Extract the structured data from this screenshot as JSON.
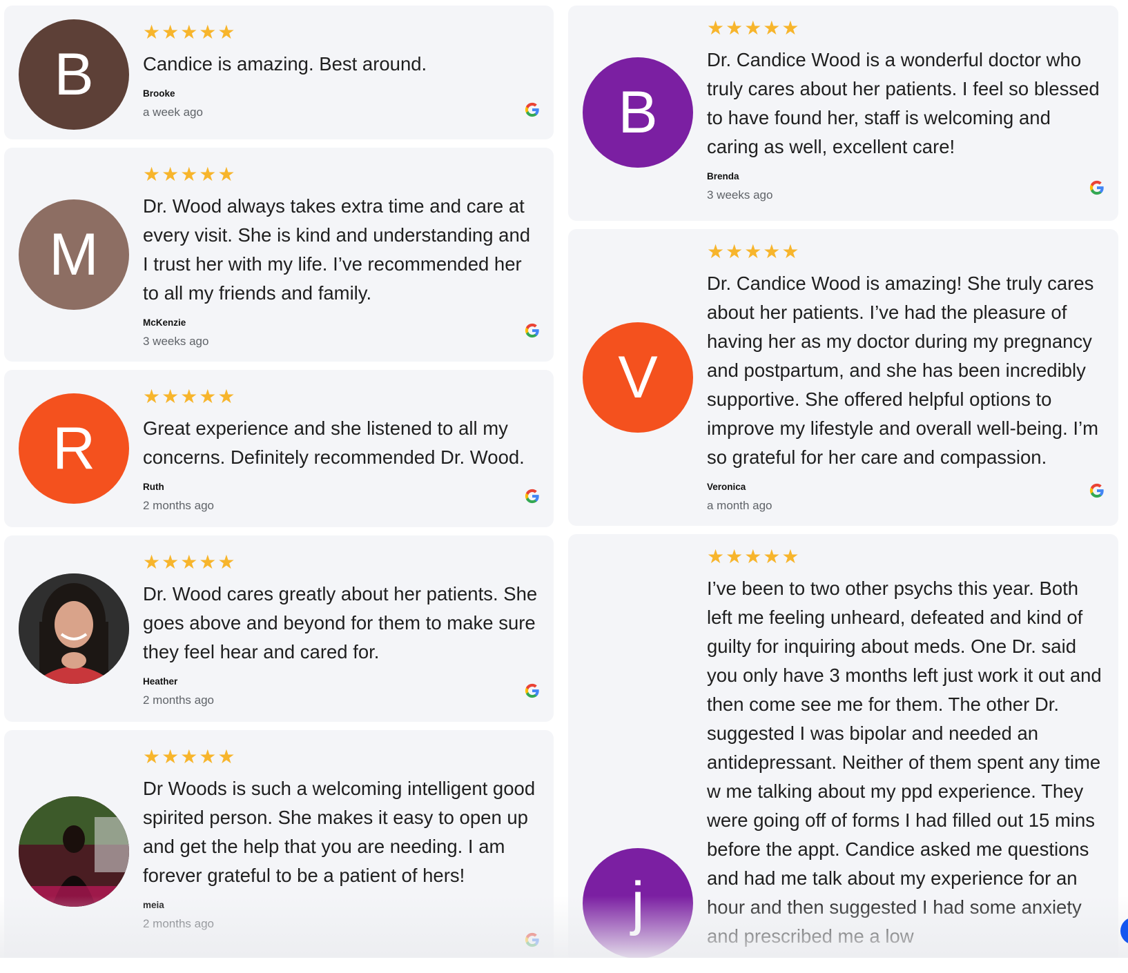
{
  "colors": {
    "star": "#f7b52c",
    "card_bg": "#f4f5f8",
    "avatar_brown_dark": "#5d4037",
    "avatar_brown_light": "#8d6e63",
    "avatar_orange": "#f4511e",
    "avatar_purple": "#7b1fa2"
  },
  "rating_stars": "★★★★★",
  "reviews_left": [
    {
      "initial": "B",
      "avatar": "letter",
      "avatar_color": "#5d4037",
      "text": "Candice is amazing. Best around.",
      "author": "Brooke",
      "date": "a week ago",
      "icon": "google-icon"
    },
    {
      "initial": "M",
      "avatar": "letter",
      "avatar_color": "#8d6e63",
      "text": "Dr. Wood always takes extra time and care at every visit. She is kind and understanding and I trust her with my life. I’ve recommended her to all my friends and family.",
      "author": "McKenzie",
      "date": "3 weeks ago",
      "icon": "google-icon"
    },
    {
      "initial": "R",
      "avatar": "letter",
      "avatar_color": "#f4511e",
      "text": "Great experience and she listened to all my concerns. Definitely recommended Dr. Wood.",
      "author": "Ruth",
      "date": "2 months ago",
      "icon": "google-icon"
    },
    {
      "initial": "",
      "avatar": "photo",
      "avatar_color": "#3a3a3a",
      "text": "Dr. Wood cares greatly about her patients. She goes above and beyond for them to make sure they feel hear and cared for.",
      "author": "Heather",
      "date": "2 months ago",
      "icon": "google-icon"
    },
    {
      "initial": "",
      "avatar": "photo",
      "avatar_color": "#3b1520",
      "text": "Dr Woods is such a welcoming intelligent good spirited person. She makes it easy to open up  and get the help that you are needing. I am forever grateful to be a patient of hers!",
      "author": "meia",
      "date": "2 months ago",
      "icon": "google-icon"
    }
  ],
  "reviews_right": [
    {
      "initial": "B",
      "avatar": "letter",
      "avatar_color": "#7b1fa2",
      "text": "Dr. Candice Wood is a wonderful doctor who truly cares about her patients. I feel so blessed to have found her, staff is welcoming and caring as well, excellent care!",
      "author": "Brenda",
      "date": "3 weeks ago",
      "icon": "google-icon"
    },
    {
      "initial": "V",
      "avatar": "letter",
      "avatar_color": "#f4511e",
      "text": "Dr. Candice Wood is amazing! She truly cares about her patients. I’ve had the pleasure of having her as my doctor during my pregnancy and postpartum, and she has been incredibly supportive. She offered helpful options to improve my lifestyle and overall well-being. I’m so grateful for her care and compassion.",
      "author": "Veronica",
      "date": "a month ago",
      "icon": "google-icon"
    },
    {
      "initial": "j",
      "avatar": "letter",
      "avatar_color": "#7b1fa2",
      "text": "I’ve been to two other psychs this year. Both left me feeling unheard, defeated and kind of guilty for inquiring about meds. One Dr. said you only have 3 months left just work it out and then come see me for them. The other Dr. suggested I was bipolar and needed an antidepressant. Neither of them spent any time w me talking about my ppd experience. They were going off of forms I had filled out 15 mins before the appt. Candice asked me questions and had me talk about my experience for an hour and then suggested I had some anxiety and prescribed me a low",
      "author": "",
      "date": "",
      "icon": ""
    }
  ]
}
